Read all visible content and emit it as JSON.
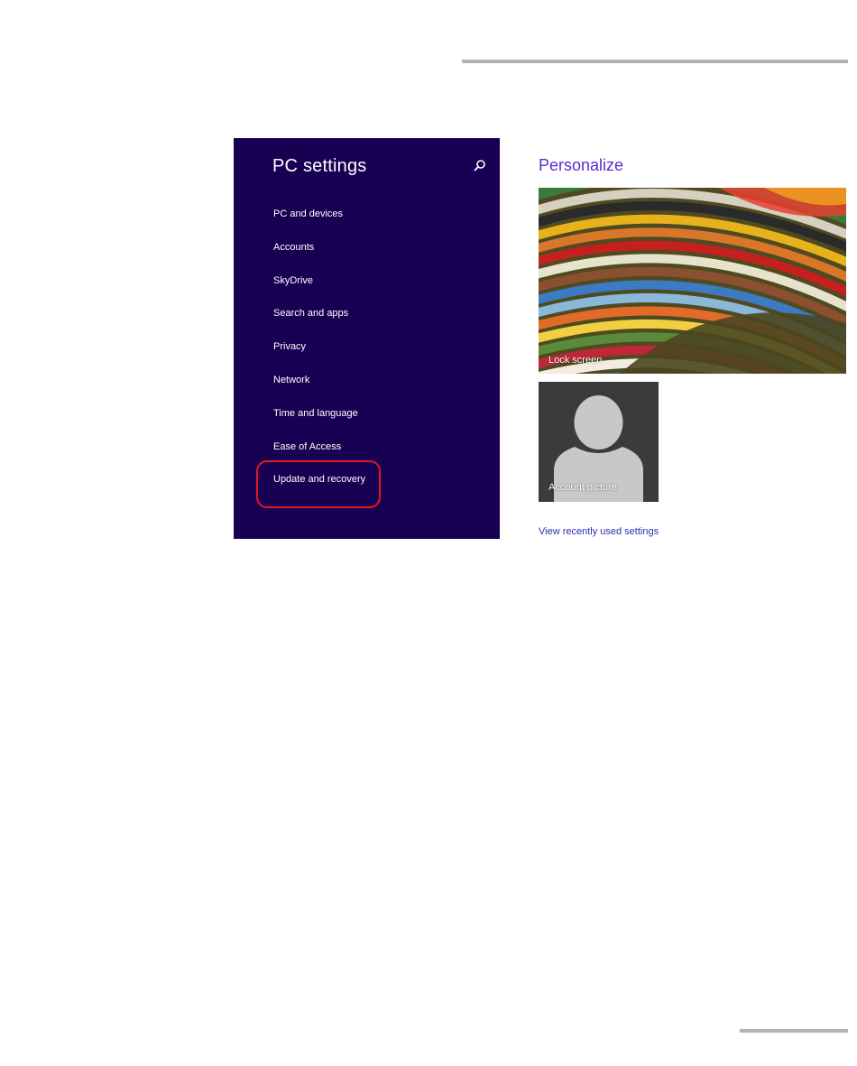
{
  "nav": {
    "title": "PC settings",
    "search_icon": "search-icon",
    "items": [
      {
        "label": "PC and devices"
      },
      {
        "label": "Accounts"
      },
      {
        "label": "SkyDrive"
      },
      {
        "label": "Search and apps"
      },
      {
        "label": "Privacy"
      },
      {
        "label": "Network"
      },
      {
        "label": "Time and language"
      },
      {
        "label": "Ease of Access"
      },
      {
        "label": "Update and recovery",
        "highlighted": true
      }
    ]
  },
  "main": {
    "title": "Personalize",
    "lock_screen_label": "Lock screen",
    "account_picture_label": "Account picture",
    "recent_link": "View recently used settings"
  },
  "colors": {
    "nav_background": "#180052",
    "accent": "#5b2bd1",
    "highlight_ring": "#e2191f",
    "link": "#2d2db5"
  }
}
